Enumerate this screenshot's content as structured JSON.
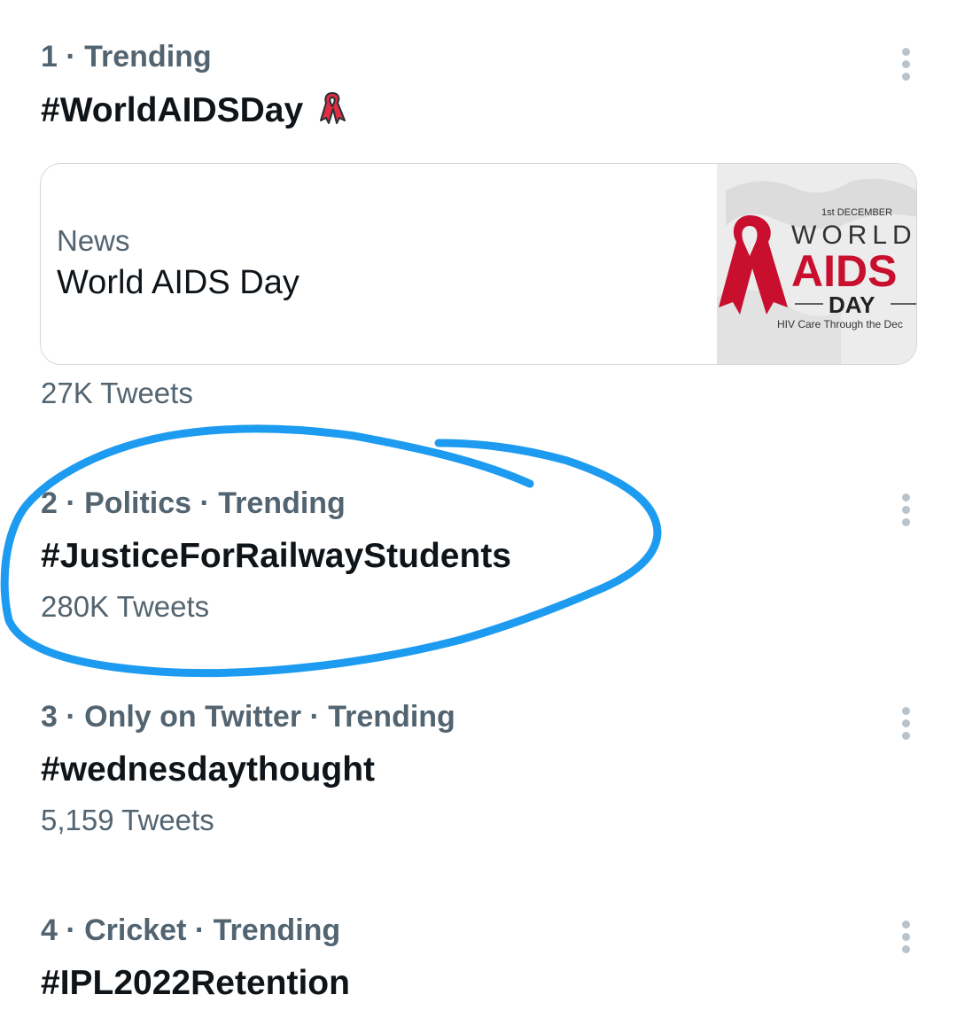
{
  "trends": [
    {
      "meta": "1 · Trending",
      "hashtag": "#WorldAIDSDay",
      "count": "27K Tweets",
      "emoji_icon": "red-ribbon-icon"
    },
    {
      "meta": "2 · Politics · Trending",
      "hashtag": "#JusticeForRailwayStudents",
      "count": "280K Tweets"
    },
    {
      "meta": "3 · Only on Twitter · Trending",
      "hashtag": "#wednesdaythought",
      "count": "5,159 Tweets"
    },
    {
      "meta": "4 · Cricket · Trending",
      "hashtag": "#IPL2022Retention"
    }
  ],
  "news_card": {
    "category": "News",
    "title": "World AIDS Day",
    "image": {
      "date_line": "1st DECEMBER",
      "line_world": "WORLD",
      "line_aids": "AIDS",
      "line_day": "DAY",
      "caption": "HIV Care Through the Dec"
    }
  },
  "colors": {
    "annotation": "#1d9bf0",
    "secondary_text": "#536471",
    "primary_text": "#0f1419",
    "ribbon": "#c8102e"
  }
}
